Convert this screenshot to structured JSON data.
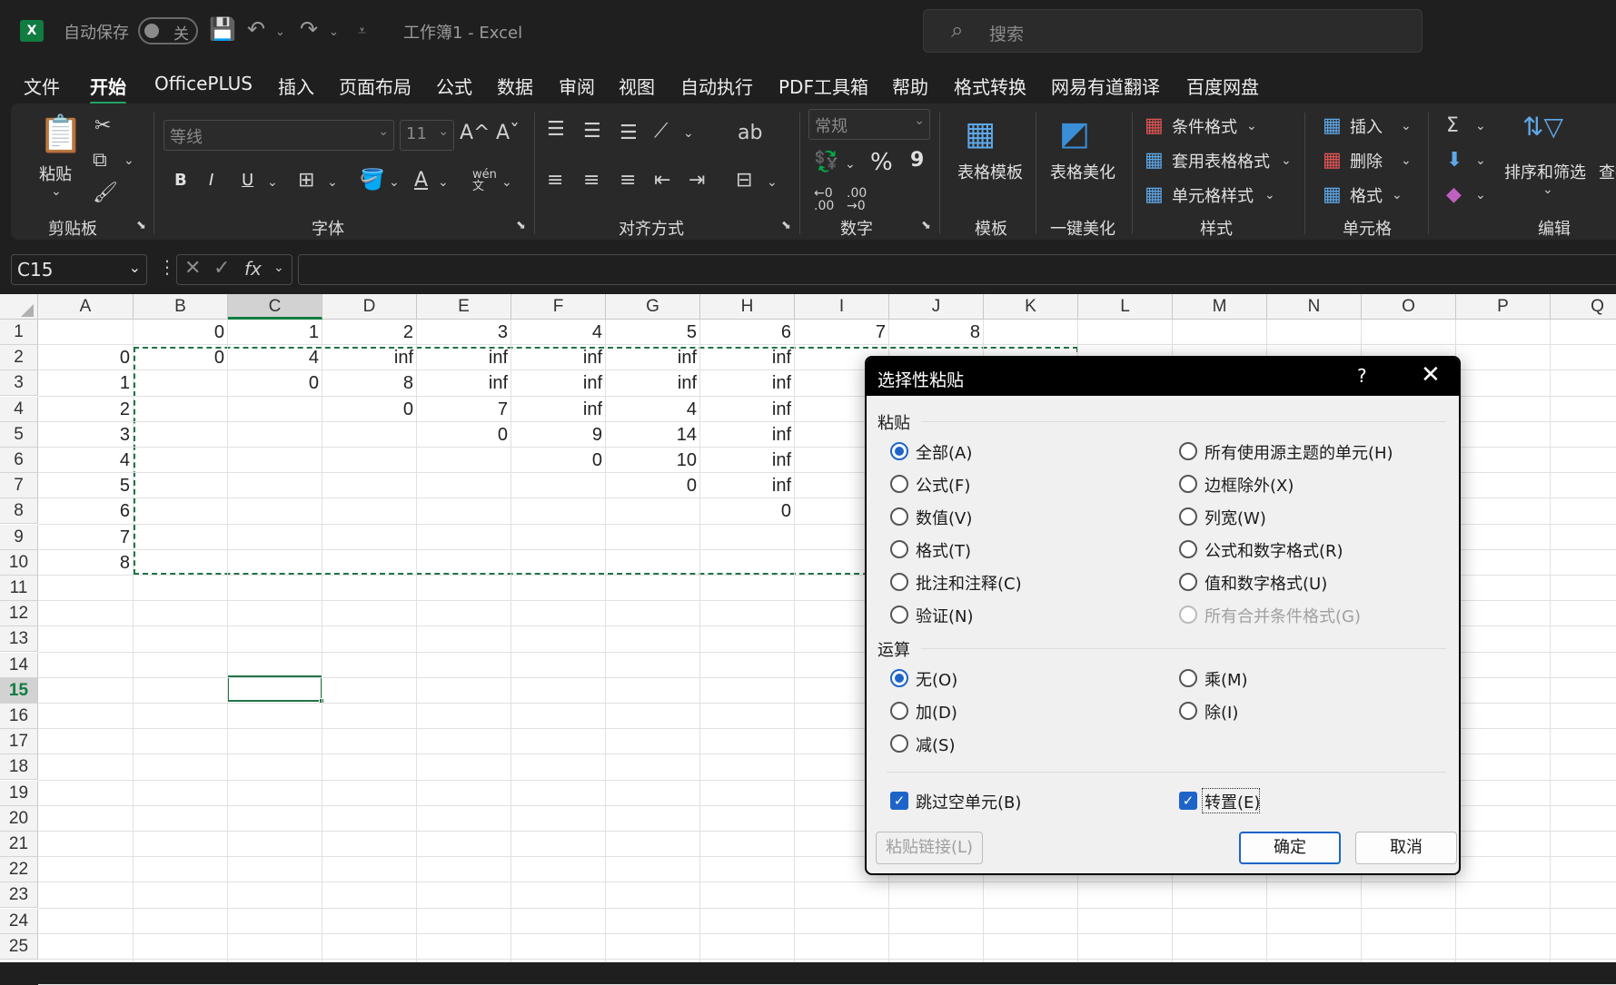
{
  "titlebar": {
    "app_logo": "X",
    "autosave_label": "自动保存",
    "autosave_state": "关",
    "doc_title": "工作簿1  -  Excel",
    "search_placeholder": "搜索"
  },
  "menu_tabs": [
    "文件",
    "开始",
    "OfficePLUS",
    "插入",
    "页面布局",
    "公式",
    "数据",
    "审阅",
    "视图",
    "自动执行",
    "PDF工具箱",
    "帮助",
    "格式转换",
    "网易有道翻译",
    "百度网盘"
  ],
  "active_tab": "开始",
  "ribbon": {
    "clipboard": {
      "paste": "粘贴",
      "label": "剪贴板"
    },
    "font": {
      "font_name": "等线",
      "font_size": "11",
      "bold": "B",
      "italic": "I",
      "underline": "U",
      "label": "字体"
    },
    "alignment": {
      "label": "对齐方式"
    },
    "number": {
      "format": "常规",
      "percent": "%",
      "comma": "9",
      "label": "数字"
    },
    "template": {
      "button": "表格模板",
      "label": "模板"
    },
    "beautify": {
      "button": "表格美化",
      "label": "一键美化"
    },
    "styles": {
      "conditional": "条件格式",
      "table_format": "套用表格格式",
      "cell_styles": "单元格样式",
      "label": "样式"
    },
    "cells": {
      "insert": "插入",
      "delete": "删除",
      "format": "格式",
      "label": "单元格"
    },
    "editing": {
      "sort_filter": "排序和筛选",
      "find": "查找",
      "label": "编辑"
    }
  },
  "formula_bar": {
    "name_box": "C15",
    "fx": "fx",
    "formula": ""
  },
  "sheet": {
    "columns": [
      "A",
      "B",
      "C",
      "D",
      "E",
      "F",
      "G",
      "H",
      "I",
      "J",
      "K",
      "L",
      "M",
      "N",
      "O",
      "P",
      "Q"
    ],
    "selected_column": "C",
    "rows": [
      "1",
      "2",
      "3",
      "4",
      "5",
      "6",
      "7",
      "8",
      "9",
      "10",
      "11",
      "12",
      "13",
      "14",
      "15",
      "16",
      "17",
      "18",
      "19",
      "20",
      "21",
      "22",
      "23",
      "24",
      "25"
    ],
    "selected_row": "15",
    "row1": [
      "0",
      "1",
      "2",
      "3",
      "4",
      "5",
      "6",
      "7",
      "8"
    ],
    "colA": [
      "0",
      "1",
      "2",
      "3",
      "4",
      "5",
      "6",
      "7",
      "8"
    ],
    "matrix": [
      [
        "0",
        "4",
        "inf",
        "inf",
        "inf",
        "inf",
        "inf"
      ],
      [
        "",
        "0",
        "8",
        "inf",
        "inf",
        "inf",
        "inf"
      ],
      [
        "",
        "",
        "0",
        "7",
        "inf",
        "4",
        "inf"
      ],
      [
        "",
        "",
        "",
        "0",
        "9",
        "14",
        "inf"
      ],
      [
        "",
        "",
        "",
        "",
        "0",
        "10",
        "inf"
      ],
      [
        "",
        "",
        "",
        "",
        "",
        "0",
        "inf"
      ],
      [
        "",
        "",
        "",
        "",
        "",
        "",
        "0"
      ]
    ]
  },
  "dialog": {
    "title": "选择性粘贴",
    "help": "?",
    "close": "✕",
    "paste_section": "粘贴",
    "paste_left": [
      "全部(A)",
      "公式(F)",
      "数值(V)",
      "格式(T)",
      "批注和注释(C)",
      "验证(N)"
    ],
    "paste_right": [
      "所有使用源主题的单元(H)",
      "边框除外(X)",
      "列宽(W)",
      "公式和数字格式(R)",
      "值和数字格式(U)",
      "所有合并条件格式(G)"
    ],
    "operation_section": "运算",
    "op_left": [
      "无(O)",
      "加(D)",
      "减(S)"
    ],
    "op_right": [
      "乘(M)",
      "除(I)"
    ],
    "skip_blanks": "跳过空单元(B)",
    "transpose": "转置(E)",
    "paste_link": "粘贴链接(L)",
    "ok": "确定",
    "cancel": "取消"
  }
}
